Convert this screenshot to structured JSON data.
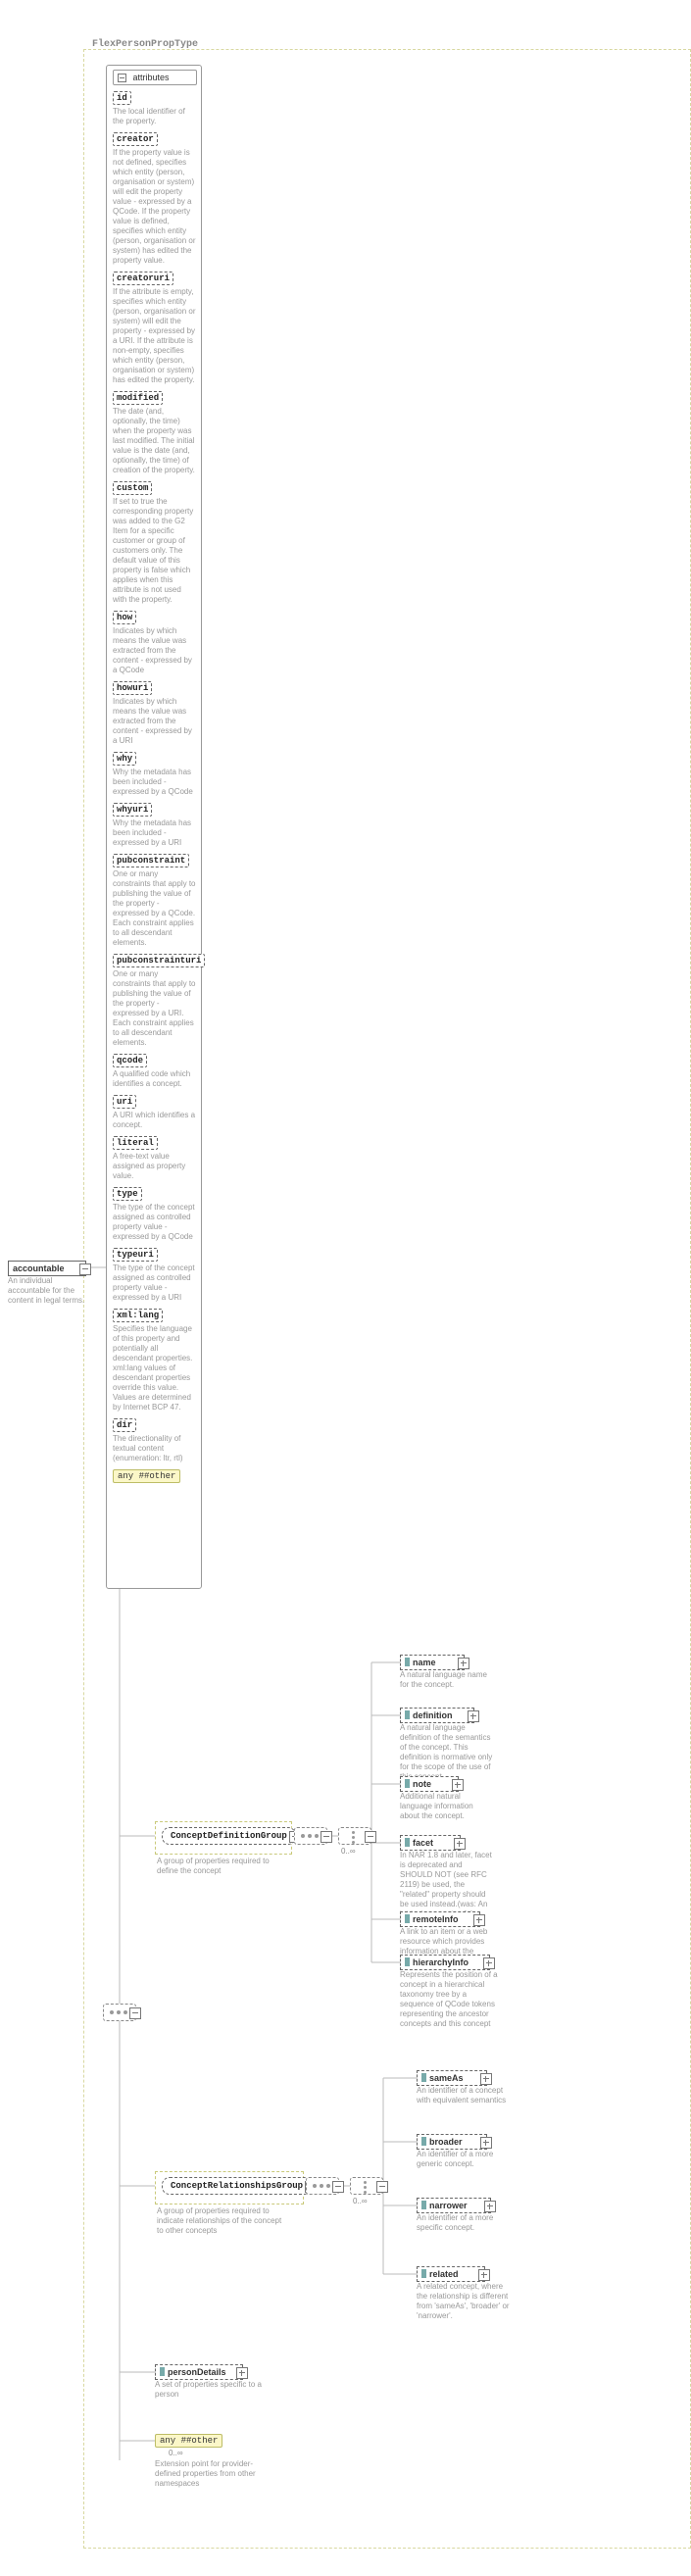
{
  "typeName": "FlexPersonPropType",
  "attributesHeader": "attributes",
  "attributes": [
    {
      "name": "id",
      "desc": "The local identifier of the property."
    },
    {
      "name": "creator",
      "desc": "If the property value is not defined, specifies which entity (person, organisation or system) will edit the property value - expressed by a QCode. If the property value is defined, specifies which entity (person, organisation or system) has edited the property value."
    },
    {
      "name": "creatoruri",
      "desc": "If the attribute is empty, specifies which entity (person, organisation or system) will edit the property - expressed by a URI. If the attribute is non-empty, specifies which entity (person, organisation or system) has edited the property."
    },
    {
      "name": "modified",
      "desc": "The date (and, optionally, the time) when the property was last modified. The initial value is the date (and, optionally, the time) of creation of the property."
    },
    {
      "name": "custom",
      "desc": "If set to true the corresponding property was added to the G2 Item for a specific customer or group of customers only. The default value of this property is false which applies when this attribute is not used with the property."
    },
    {
      "name": "how",
      "desc": "Indicates by which means the value was extracted from the content - expressed by a QCode"
    },
    {
      "name": "howuri",
      "desc": "Indicates by which means the value was extracted from the content - expressed by a URI"
    },
    {
      "name": "why",
      "desc": "Why the metadata has been included - expressed by a QCode"
    },
    {
      "name": "whyuri",
      "desc": "Why the metadata has been included - expressed by a URI"
    },
    {
      "name": "pubconstraint",
      "desc": "One or many constraints that apply to publishing the value of the property - expressed by a QCode. Each constraint applies to all descendant elements."
    },
    {
      "name": "pubconstrainturi",
      "desc": "One or many constraints that apply to publishing the value of the property - expressed by a URI. Each constraint applies to all descendant elements."
    },
    {
      "name": "qcode",
      "desc": "A qualified code which identifies a concept."
    },
    {
      "name": "uri",
      "desc": "A URI which identifies a concept."
    },
    {
      "name": "literal",
      "desc": "A free-text value assigned as property value."
    },
    {
      "name": "type",
      "desc": "The type of the concept assigned as controlled property value - expressed by a QCode"
    },
    {
      "name": "typeuri",
      "desc": "The type of the concept assigned as controlled property value - expressed by a URI"
    },
    {
      "name": "xml:lang",
      "desc": "Specifies the language of this property and potentially all descendant properties. xml:lang values of descendant properties override this value. Values are determined by Internet BCP 47."
    },
    {
      "name": "dir",
      "desc": "The directionality of textual content (enumeration: ltr, rtl)"
    }
  ],
  "attrAny": "any ##other",
  "root": {
    "name": "accountable",
    "desc": "An individual accountable for the content in legal terms."
  },
  "groups": {
    "def": {
      "label": "ConceptDefinitionGroup",
      "desc": "A group of properties required to define the concept",
      "cardinality": "0..∞"
    },
    "rel": {
      "label": "ConceptRelationshipsGroup",
      "desc": "A group of properties required to indicate relationships of the concept to other concepts",
      "cardinality": "0..∞"
    }
  },
  "leaves": {
    "name": {
      "label": "name",
      "desc": "A natural language name for the concept."
    },
    "definition": {
      "label": "definition",
      "desc": "A natural language definition of the semantics of the concept. This definition is normative only for the scope of the use of this concept."
    },
    "note": {
      "label": "note",
      "desc": "Additional natural language information about the concept."
    },
    "facet": {
      "label": "facet",
      "desc": "In NAR 1.8 and later, facet is deprecated and SHOULD NOT (see RFC 2119) be used, the \"related\" property should be used instead.(was: An intrinsic property of the concept.)"
    },
    "remoteInfo": {
      "label": "remoteInfo",
      "desc": "A link to an item or a web resource which provides information about the concept"
    },
    "hierarchyInfo": {
      "label": "hierarchyInfo",
      "desc": "Represents the position of a concept in a hierarchical taxonomy tree by a sequence of QCode tokens representing the ancestor concepts and this concept"
    },
    "sameAs": {
      "label": "sameAs",
      "desc": "An identifier of a concept with equivalent semantics"
    },
    "broader": {
      "label": "broader",
      "desc": "An identifier of a more generic concept."
    },
    "narrower": {
      "label": "narrower",
      "desc": "An identifier of a more specific concept."
    },
    "related": {
      "label": "related",
      "desc": "A related concept, where the relationship is different from 'sameAs', 'broader' or 'narrower'."
    }
  },
  "personDetails": {
    "label": "personDetails",
    "desc": "A set of properties specific to a person"
  },
  "anyOtherBottom": {
    "label": "any ##other",
    "cardinality": "0..∞",
    "desc": "Extension point for provider-defined properties from other namespaces"
  }
}
